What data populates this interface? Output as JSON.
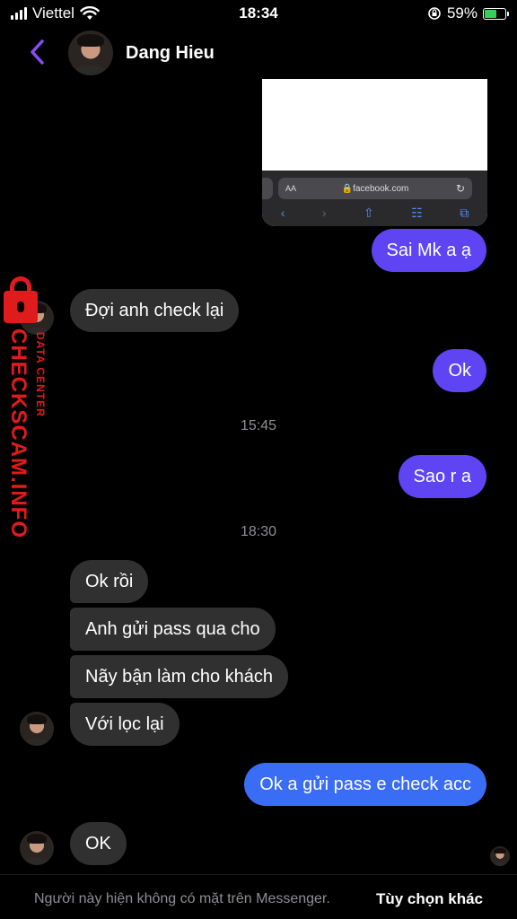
{
  "status_bar": {
    "carrier": "Viettel",
    "time": "18:34",
    "battery": "59%",
    "battery_level": 0.59
  },
  "header": {
    "contact_name": "Dang Hieu",
    "back_icon": "chevron-left-icon"
  },
  "shared_image": {
    "aa_label": "AA",
    "url": "🔒facebook.com"
  },
  "messages": {
    "m1": "Sai Mk a ạ",
    "m2": "Đợi anh check lại",
    "m3": "Ok",
    "ts1": "15:45",
    "m4": "Sao r a",
    "ts2": "18:30",
    "m5": "Ok rồi",
    "m6": "Anh gửi pass qua cho",
    "m7": "Nãy bận làm cho khách",
    "m8": "Với lọc lại",
    "m9": "Ok a gửi pass e check acc",
    "m10": "OK"
  },
  "watermark": {
    "main": "CHECKSCAM.INFO",
    "sub": "DATA CENTER"
  },
  "footer": {
    "status_text": "Người này hiện không có mặt trên Messenger.",
    "options_link": "Tùy chọn khác"
  },
  "colors": {
    "sent_bubble": "#5f44f3",
    "sent_bubble_blue": "#3a6df6",
    "received_bubble": "#303030",
    "accent_back": "#8a4cf6",
    "watermark_red": "#e01b1b"
  }
}
